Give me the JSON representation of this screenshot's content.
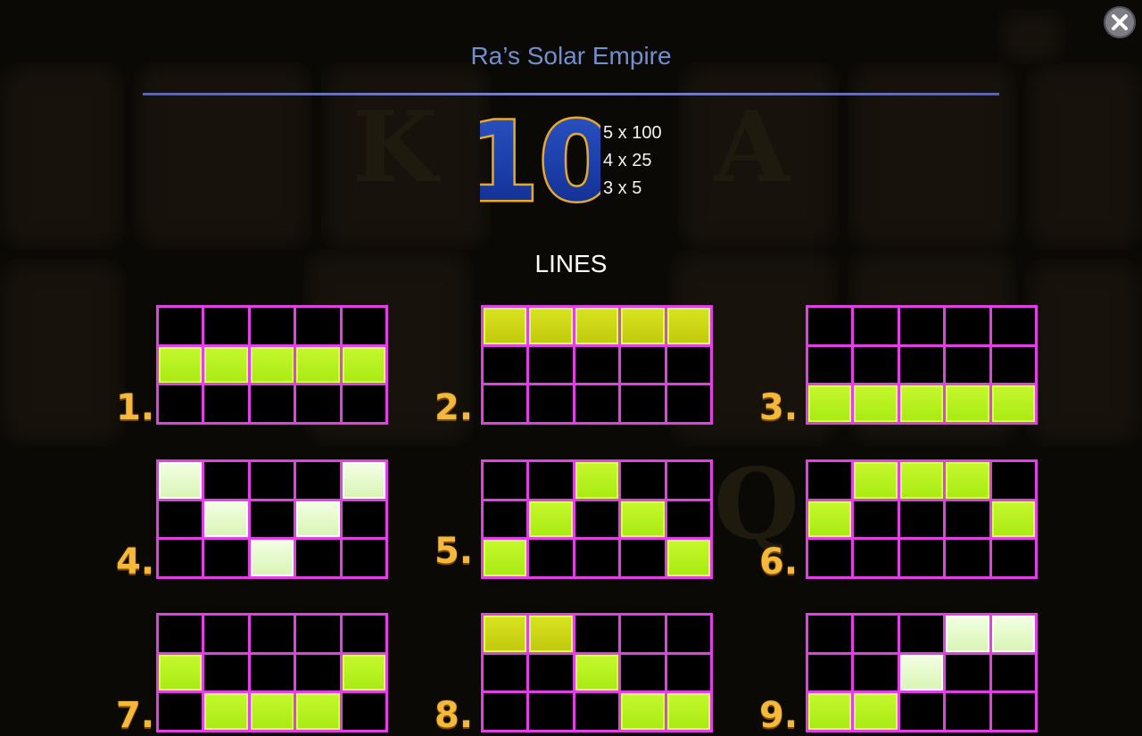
{
  "header": {
    "title": "Ra’s Solar Empire",
    "close_icon": "close-icon"
  },
  "symbol": {
    "label": "10",
    "payouts": [
      "5 x 100",
      "4 x 25",
      "3 x 5"
    ]
  },
  "lines_section": {
    "heading": "LINES",
    "lines": [
      {
        "number": "1.",
        "pattern": [
          1,
          1,
          1,
          1,
          1
        ]
      },
      {
        "number": "2.",
        "pattern": [
          0,
          0,
          0,
          0,
          0
        ]
      },
      {
        "number": "3.",
        "pattern": [
          2,
          2,
          2,
          2,
          2
        ]
      },
      {
        "number": "4.",
        "pattern": [
          0,
          1,
          2,
          1,
          0
        ]
      },
      {
        "number": "5.",
        "pattern": [
          2,
          1,
          0,
          1,
          2
        ]
      },
      {
        "number": "6.",
        "pattern": [
          1,
          0,
          0,
          0,
          1
        ]
      },
      {
        "number": "7.",
        "pattern": [
          1,
          2,
          2,
          2,
          1
        ]
      },
      {
        "number": "8.",
        "pattern": [
          0,
          0,
          1,
          2,
          2
        ]
      },
      {
        "number": "9.",
        "pattern": [
          2,
          2,
          1,
          0,
          0
        ]
      }
    ]
  },
  "colors": {
    "grid_border": "#e43fe6",
    "active_cell": "#b4f01c",
    "line_number": "#f4b83a",
    "title": "#6f8fcf"
  }
}
